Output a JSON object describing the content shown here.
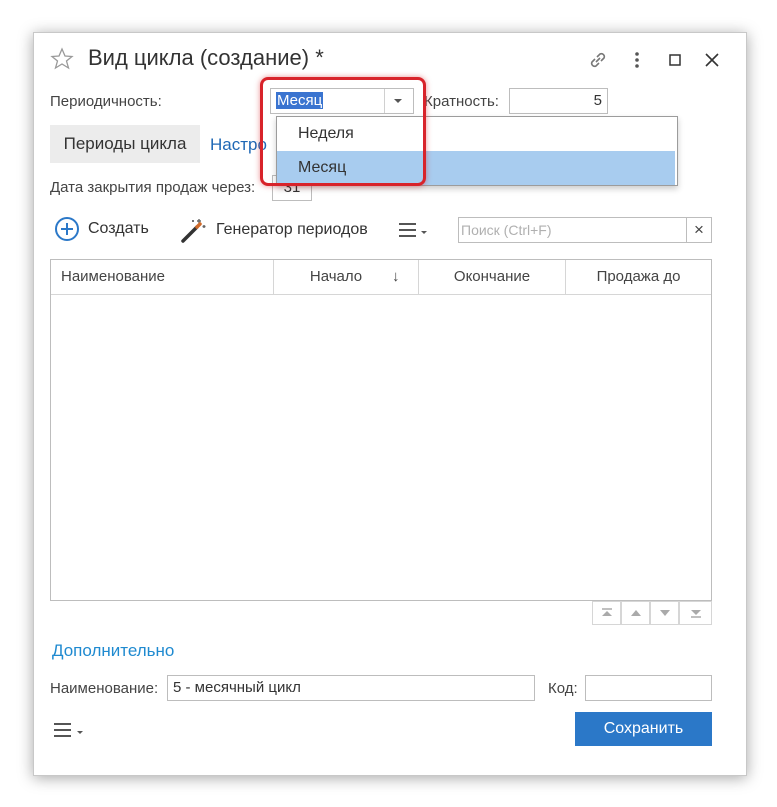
{
  "window": {
    "title": "Вид цикла (создание) *",
    "icons": [
      "star-icon",
      "link-icon",
      "more-vertical-icon",
      "maximize-icon",
      "close-icon"
    ]
  },
  "periodicity": {
    "label": "Периодичность:",
    "value": "Месяц"
  },
  "multiplicity": {
    "label": "Кратность:",
    "value": "5"
  },
  "tabs": [
    {
      "label": "Периоды цикла",
      "active": true
    },
    {
      "label": "Настро",
      "active": false
    }
  ],
  "close_sales": {
    "label": "Дата закрытия продаж через:",
    "value": "31"
  },
  "toolbar": {
    "create_label": "Создать",
    "generator_label": "Генератор периодов",
    "search_placeholder": "Поиск (Ctrl+F)",
    "clear_label": "×"
  },
  "table": {
    "columns": [
      "Наименование",
      "Начало",
      "Окончание",
      "Продажа до"
    ],
    "sort_indicator": "↓",
    "rows": []
  },
  "more_link": "Дополнительно",
  "name_field": {
    "label": "Наименование:",
    "value": "5 - месячный цикл"
  },
  "code_field": {
    "label": "Код:",
    "value": ""
  },
  "save_label": "Сохранить",
  "dropdown": {
    "options": [
      "Неделя",
      "Месяц"
    ],
    "selected": "Месяц"
  },
  "colors": {
    "accent": "#2b78c8",
    "link": "#1f68b5",
    "highlight": "#d8232a",
    "selection": "#a8ccef"
  }
}
